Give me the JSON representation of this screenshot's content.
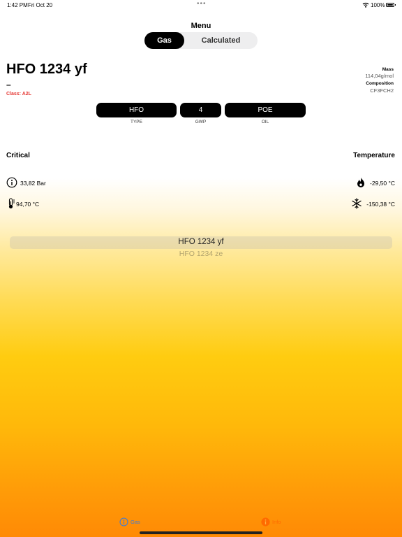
{
  "status_bar": {
    "time": "1:42 PM",
    "date": "Fri Oct 20",
    "battery": "100%"
  },
  "header": {
    "title": "Menu"
  },
  "segments": {
    "gas": "Gas",
    "calculated": "Calculated",
    "selected": "Gas"
  },
  "gas": {
    "name": "HFO 1234 yf",
    "subtitle": "–",
    "class_label": "Class: A2L",
    "mass_label": "Mass",
    "mass_value": "114,04g/mol",
    "composition_label": "Composition",
    "composition_value": "CF3FCH2"
  },
  "badges": [
    {
      "value": "HFO",
      "caption": "TYPE"
    },
    {
      "value": "4",
      "caption": "GWP"
    },
    {
      "value": "POE",
      "caption": "OIL"
    }
  ],
  "sections": {
    "left": "Critical",
    "right": "Temperature"
  },
  "critical": {
    "pressure": "33,82 Bar",
    "temperature": "94,70 °C"
  },
  "temperature": {
    "boiling": "-29,50 °C",
    "freezing": "-150,38 °C"
  },
  "picker": {
    "selected": "HFO 1234 yf",
    "next": "HFO 1234 ze"
  },
  "tabbar": {
    "gas": "Gas",
    "info": "Info"
  },
  "colors": {
    "accent_red": "#e53935",
    "tab_blue": "#3d7bd9",
    "tab_orange": "#ff6a00"
  }
}
